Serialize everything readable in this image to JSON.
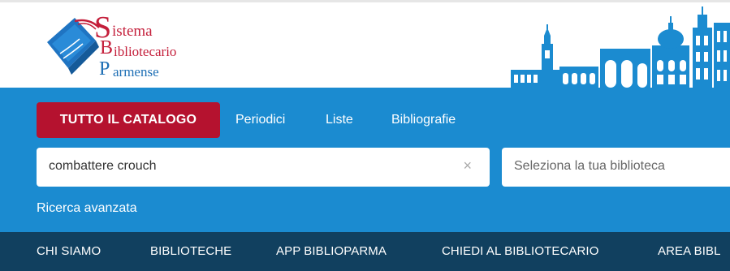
{
  "logo": {
    "line1_initial": "S",
    "line1_rest": "istema",
    "line2_initial": "B",
    "line2_rest": "ibliotecario",
    "line3_initial": "P",
    "line3_rest": "armense"
  },
  "tabs": {
    "active": "TUTTO IL CATALOGO",
    "items": [
      "Periodici",
      "Liste",
      "Bibliografie"
    ]
  },
  "search": {
    "value": "combattere crouch",
    "clear": "×"
  },
  "library": {
    "placeholder": "Seleziona la tua biblioteca"
  },
  "advanced": "Ricerca avanzata",
  "nav": [
    "CHI SIAMO",
    "BIBLIOTECHE",
    "APP BIBLIOPARMA",
    "CHIEDI AL BIBLIOTECARIO",
    "AREA BIBL"
  ],
  "colors": {
    "accent_red": "#b5122f",
    "blue_band": "#1b8bd0",
    "nav_dark": "#11405f"
  }
}
